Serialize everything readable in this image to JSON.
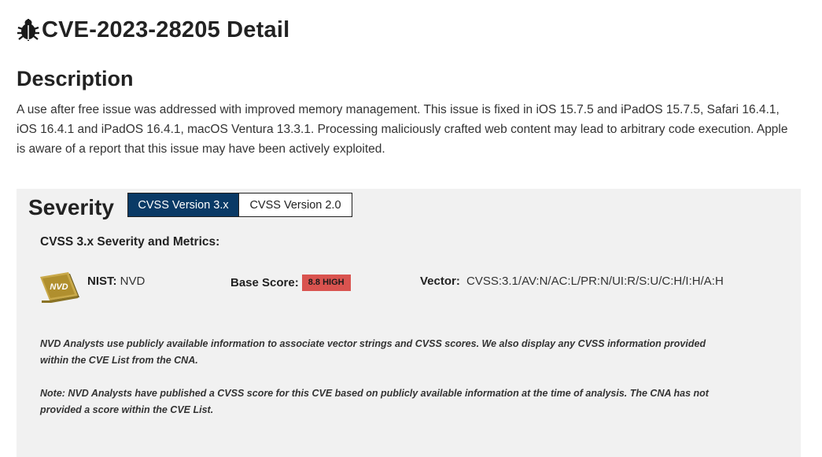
{
  "header": {
    "title": "CVE-2023-28205 Detail",
    "icon": "bug-icon"
  },
  "description": {
    "heading": "Description",
    "text": "A use after free issue was addressed with improved memory management. This issue is fixed in iOS 15.7.5 and iPadOS 15.7.5, Safari 16.4.1, iOS 16.4.1 and iPadOS 16.4.1, macOS Ventura 13.3.1. Processing maliciously crafted web content may lead to arbitrary code execution. Apple is aware of a report that this issue may have been actively exploited."
  },
  "severity": {
    "heading": "Severity",
    "tabs": [
      {
        "label": "CVSS Version 3.x",
        "active": true
      },
      {
        "label": "CVSS Version 2.0",
        "active": false
      }
    ],
    "metrics_heading": "CVSS 3.x Severity and Metrics:",
    "nvd_logo_text": "NVD",
    "nist_label": "NIST:",
    "nist_value": "NVD",
    "base_score_label": "Base Score:",
    "base_score_value": "8.8 HIGH",
    "vector_label": "Vector:",
    "vector_value": "CVSS:3.1/AV:N/AC:L/PR:N/UI:R/S:U/C:H/I:H/A:H",
    "note1": "NVD Analysts use publicly available information to associate vector strings and CVSS scores. We also display any CVSS information provided within the CVE List from the CNA.",
    "note2": "Note: NVD Analysts have published a CVSS score for this CVE based on publicly available information at the time of analysis. The CNA has not provided a score within the CVE List."
  },
  "colors": {
    "tab_active_bg": "#0a3a66",
    "badge_high": "#d9534f",
    "panel_bg": "#f1f1f1"
  }
}
